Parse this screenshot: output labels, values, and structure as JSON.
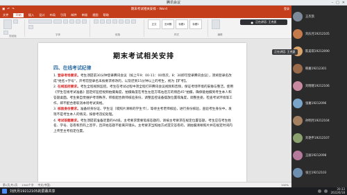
{
  "meeting": {
    "title": "腾讯会议",
    "speaker_tag": "正在讲话: 王杰凯",
    "float_bar_label": "正在讲话: 王杰凯",
    "status_text": "刘庆月19212105的屏幕共享",
    "time": "20:33",
    "date": "2022/6/18"
  },
  "word": {
    "doc_name": "期末考试相关安排 - Word",
    "signin": "登录",
    "tabs": [
      "文件",
      "开始",
      "插入",
      "设计",
      "布局",
      "引用",
      "邮件",
      "审阅",
      "视图",
      "帮助"
    ],
    "active_tab": "开始",
    "groups": [
      "剪贴板",
      "字体",
      "段落",
      "样式",
      "编辑"
    ],
    "styles": [
      "正文",
      "无间隔",
      "标题1",
      "标题2"
    ],
    "status": {
      "page": "第1页,共1页",
      "words": "1340个字",
      "lang": "中文(中国)",
      "zoom": "100%"
    }
  },
  "document": {
    "title": "期末考试相关安排",
    "section": "四、在线考试纪律",
    "paragraphs": [
      {
        "num": "1.",
        "red": "登录考场要求。",
        "text": "考生须提前30分钟登录腾讯会议（如上午9：00-11：00场次，8：30即可登录腾讯会议），须将登录名改成“姓名+学号”，开考前登录名未按要求修改的，以及迟到15分钟以上的考生，视为【旷考】。"
      },
      {
        "num": "2.",
        "red": "在线监控要求。",
        "text": "考生全程视频监控。考生在考试过程中须全程打开腾讯会议视频和音频，保证考场环境的安静与整洁。使用《学生在线考试准备》固定好监控视频拍摄角度，拍摄角度在考生左后方或右后方的侧后45°拍摄，确保能拍摄到考生本人和答题桌面。考生要自觉维护考场秩序，积极配合教师核验身份，调整监控设备摆放位置或角度，调整坐姿，检查考试环境等工作，即不配合者取消本场考试资格。"
      },
      {
        "num": "3.",
        "red": "核验身份要求。",
        "text": "准备好身份证、学生证（或照片清晰的学生卡），等待主考老师核验，进行身份核验，查验考生身份中，发现不是考生本人的情况，按替考违纪处理。"
      },
      {
        "num": "4.",
        "red": "考试答题要求。",
        "text": "考生须提前准备足量的A4纸，主考要求需要笔纸答题的，请按主考要求在规定位置答题，考生应在考生姓名、学号、答卷和页码上签字，且开始答题不能离开镜头。主考要求当照拍方式提交答卷的，请拍摄清晰照片并在规定时间内上传至主考指定位置。"
      }
    ]
  },
  "participants": [
    {
      "name": "王杰凯",
      "color": "#7d8a9a"
    },
    {
      "name": "刘庆月19212105",
      "color": "#c47a4a"
    },
    {
      "name": "陈美琪19212090",
      "color": "#d9a36b"
    },
    {
      "name": "韩嘉19212301",
      "color": "#9a6b4a"
    },
    {
      "name": "刘晓晓19212106",
      "color": "#c98aa1"
    },
    {
      "name": "张嘉19212096",
      "color": "#7aa5c9"
    },
    {
      "name": "孙明月19212104",
      "color": "#a38060"
    },
    {
      "name": "刘艳平19212107",
      "color": "#8ba26f"
    },
    {
      "name": "王丽19212098",
      "color": "#b57a9c"
    },
    {
      "name": "张兰19212103",
      "color": "#6f8fb0"
    }
  ]
}
